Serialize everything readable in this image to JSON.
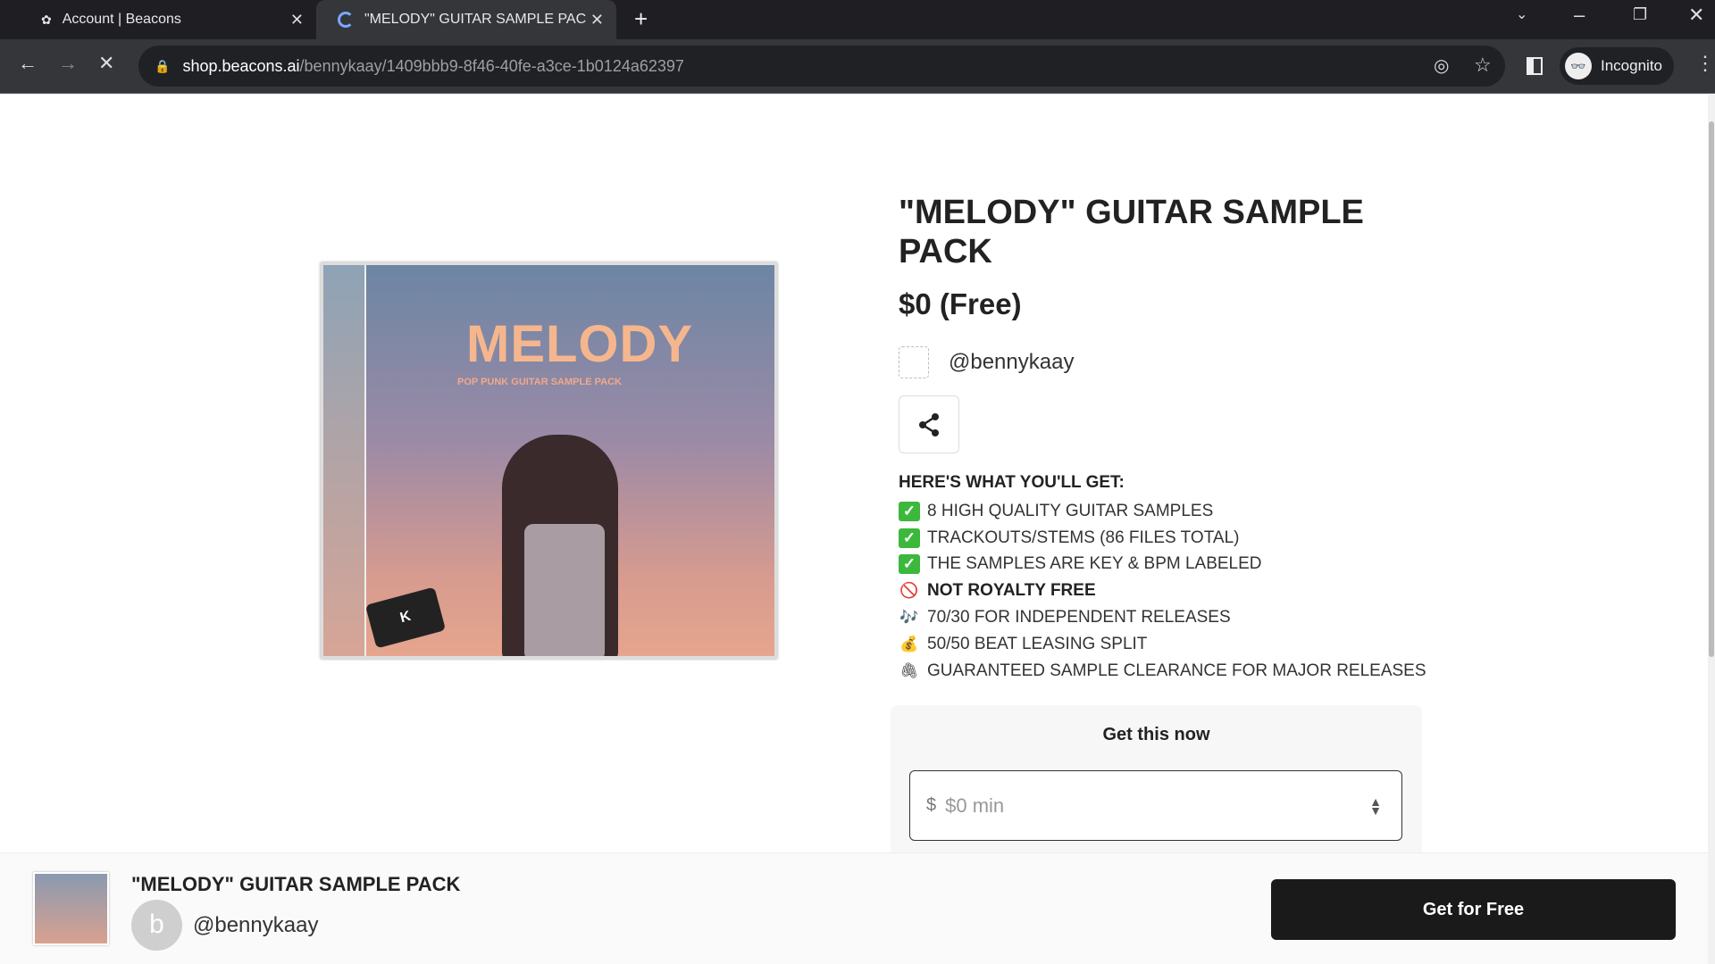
{
  "browser": {
    "tabs": [
      {
        "title": "Account | Beacons",
        "active": false
      },
      {
        "title": "\"MELODY\" GUITAR SAMPLE PAC",
        "active": true
      }
    ],
    "url_domain": "shop.beacons.ai",
    "url_path": "/bennykaay/1409bbb9-8f46-40fe-a3ce-1b0124a62397",
    "profile": "Incognito"
  },
  "product": {
    "title": "\"MELODY\" GUITAR SAMPLE PACK",
    "price": "$0 (Free)",
    "seller": "@bennykaay",
    "cover": {
      "title": "MELODY",
      "subtitle": "POP PUNK GUITAR SAMPLE PACK",
      "badge": "K"
    },
    "features_heading": "HERE'S WHAT YOU'LL GET:",
    "features": [
      {
        "icon": "check-box-icon",
        "emoji": "✓",
        "text": "8 HIGH QUALITY GUITAR SAMPLES"
      },
      {
        "icon": "check-box-icon",
        "emoji": "✓",
        "text": "TRACKOUTS/STEMS (86 FILES TOTAL)"
      },
      {
        "icon": "check-box-icon",
        "emoji": "✓",
        "text": "THE SAMPLES ARE KEY & BPM LABELED"
      },
      {
        "icon": "prohibited-icon",
        "emoji": "🚫",
        "text": "NOT ROYALTY FREE"
      },
      {
        "icon": "music-notes-icon",
        "emoji": "🎶",
        "text": "70/30 FOR INDEPENDENT RELEASES"
      },
      {
        "icon": "money-bag-icon",
        "emoji": "💰",
        "text": "50/50 BEAT LEASING SPLIT"
      },
      {
        "icon": "paperclip-icon",
        "emoji": "🖇",
        "text": "GUARANTEED SAMPLE CLEARANCE FOR MAJOR RELEASES"
      }
    ]
  },
  "purchase": {
    "heading": "Get this now",
    "currency": "$",
    "placeholder": "$0 min"
  },
  "bottom_bar": {
    "title": "\"MELODY\" GUITAR SAMPLE PACK",
    "avatar_letter": "b",
    "seller": "@bennykaay",
    "button": "Get for Free"
  }
}
